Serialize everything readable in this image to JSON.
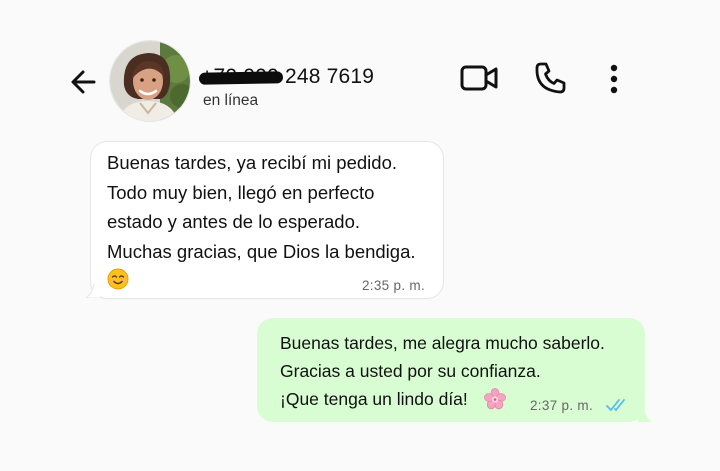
{
  "header": {
    "contact_redacted": "+70 000",
    "contact_number_visible": " 248 7619",
    "status": "en línea",
    "icons": {
      "back": "arrow-left-icon",
      "video": "video-camera-icon",
      "call": "phone-icon",
      "menu": "more-vertical-icon"
    }
  },
  "messages": {
    "incoming": {
      "lines": [
        "Buenas tardes, ya recibí mi pedido.",
        "Todo muy bien, llegó en perfecto",
        "estado y antes de lo esperado.",
        "Muchas gracias, que Dios la bendiga."
      ],
      "emoji": "smiling-face-emoji",
      "time": "2:35 p. m."
    },
    "outgoing": {
      "lines": [
        "Buenas tardes, me alegra mucho saberlo.",
        "Gracias a usted por su confianza.",
        "¡Que tenga un lindo día!"
      ],
      "emoji": "cherry-blossom-emoji",
      "time": "2:37 p. m.",
      "read_receipt": "double-check-read-icon"
    }
  },
  "colors": {
    "background": "#fafafa",
    "incoming_bubble": "#ffffff",
    "outgoing_bubble": "#d9fdd3",
    "read_ticks": "#53bdeb",
    "meta_text": "#666666"
  }
}
